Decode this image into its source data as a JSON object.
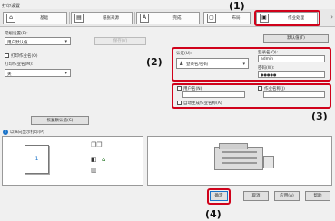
{
  "window": {
    "title": "打印设置"
  },
  "tabs": [
    {
      "label": "基础",
      "icon": "home-icon"
    },
    {
      "label": "纸张来源",
      "icon": "paper-icon"
    },
    {
      "label": "完成",
      "icon": "finishing-icon"
    },
    {
      "label": "布局",
      "icon": "layout-icon"
    },
    {
      "label": "作业处理",
      "icon": "job-handling-icon",
      "active": true
    }
  ],
  "left": {
    "user_settings_label": "常规设置(F):",
    "user_settings_value": "用户默认值",
    "save_button": "保存(V)",
    "checkbox1_label": "打印作业名(O)",
    "dropdown2_label": "打印作业名(M):",
    "dropdown2_value": "关",
    "restore_button": "恢复默认值(S)",
    "info_label": "以纵向显示打印(P)"
  },
  "right": {
    "default_button": "默认值(T)",
    "group2": {
      "auth_label": "认证(U):",
      "auth_value": "登录名/密码",
      "login_label": "登录名(Q):",
      "login_value": "admin",
      "password_label": "密码(W):",
      "password_value": "●●●●●"
    },
    "group3": {
      "user_name_label": "用户名(N)",
      "job_name_label": "作业名称(J)",
      "job_id_label": "自动生成作业名称(A)"
    }
  },
  "preview": {
    "page_number": "1"
  },
  "footer": {
    "ok": "确定",
    "cancel": "取消",
    "apply": "应用(A)",
    "help": "帮助"
  },
  "callouts": {
    "c1": "(1)",
    "c2": "(2)",
    "c3": "(3)",
    "c4": "(4)"
  },
  "colors": {
    "highlight": "#d0021b",
    "accent": "#1a73c9"
  }
}
